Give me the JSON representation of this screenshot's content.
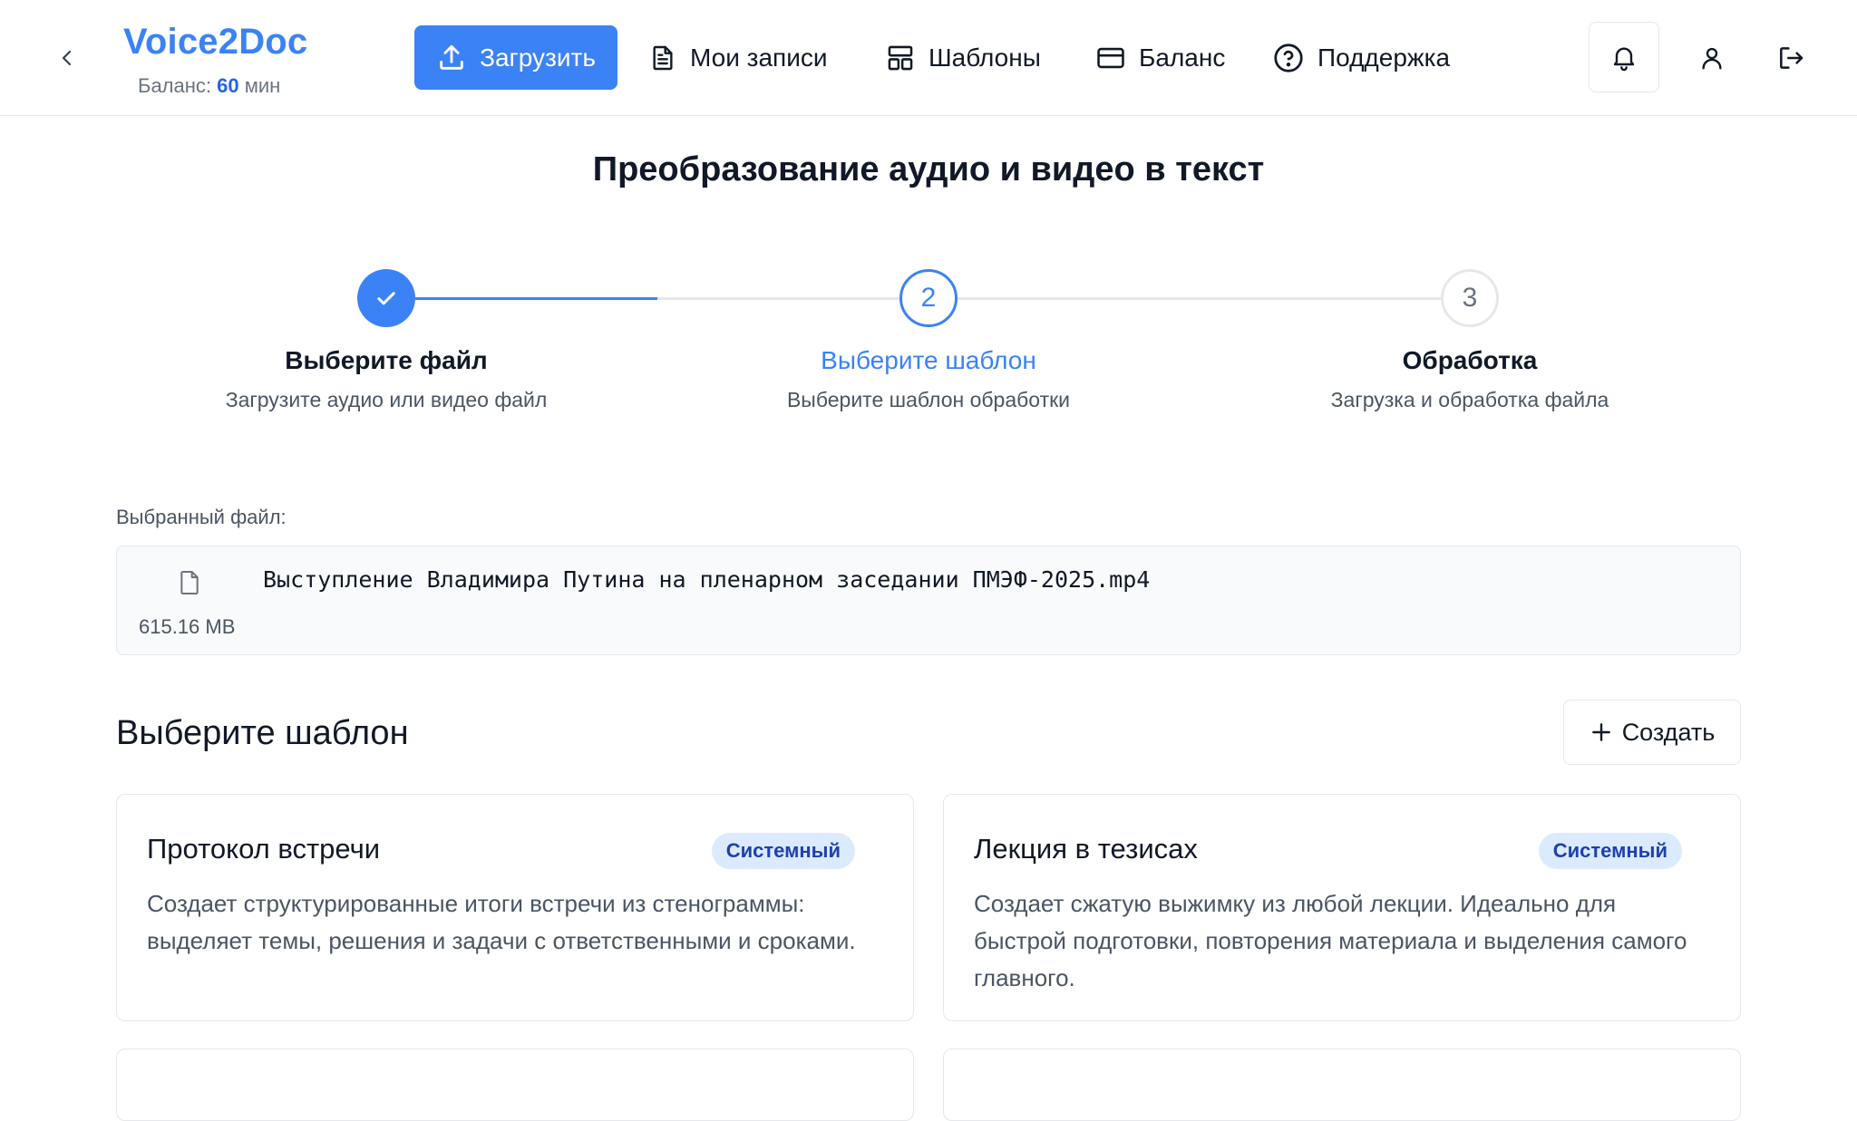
{
  "header": {
    "app_name": "Voice2Doc",
    "balance_label": "Баланс:",
    "balance_value": "60",
    "balance_unit": "мин",
    "nav": {
      "upload": "Загрузить",
      "records": "Мои записи",
      "templates": "Шаблоны",
      "balance": "Баланс",
      "support": "Поддержка"
    },
    "icons": [
      "chevron-left-icon",
      "upload-icon",
      "document-icon",
      "layout-icon",
      "credit-card-icon",
      "help-circle-icon",
      "bell-icon",
      "user-icon",
      "logout-icon"
    ]
  },
  "page": {
    "title": "Преобразование аудио и видео в текст"
  },
  "steps": [
    {
      "number": "1",
      "title": "Выберите файл",
      "subtitle": "Загрузите аудио или видео файл",
      "state": "done"
    },
    {
      "number": "2",
      "title": "Выберите шаблон",
      "subtitle": "Выберите шаблон обработки",
      "state": "active"
    },
    {
      "number": "3",
      "title": "Обработка",
      "subtitle": "Загрузка и обработка файла",
      "state": "pending"
    }
  ],
  "selected_file": {
    "label": "Выбранный файл:",
    "name": "Выступление Владимира Путина на пленарном заседании ПМЭФ-2025.mp4",
    "size": "615.16 MB"
  },
  "templates_section": {
    "title": "Выберите шаблон",
    "create_label": "Создать",
    "cards": [
      {
        "title": "Протокол встречи",
        "badge": "Системный",
        "description": "Создает структурированные итоги встречи из стенограммы: выделяет темы, решения и задачи с ответственными и сроками."
      },
      {
        "title": "Лекция в тезисах",
        "badge": "Системный",
        "description": "Создает сжатую выжимку из любой лекции. Идеально для быстрой подготовки, повторения материала и выделения самого главного."
      }
    ]
  },
  "colors": {
    "accent": "#3b82f6",
    "badge_bg": "#dbeafe",
    "badge_text": "#1e40af",
    "border": "#e5e7eb",
    "muted_text": "#4b5563"
  }
}
